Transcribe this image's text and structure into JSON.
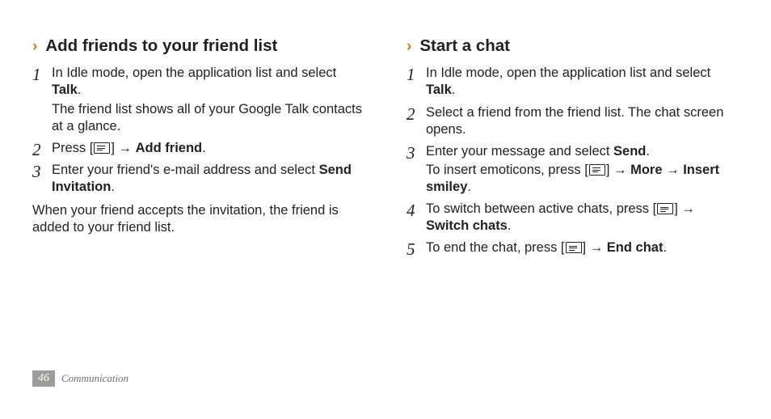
{
  "left": {
    "title": "Add friends to your friend list",
    "step1a": "In Idle mode, open the application list and select ",
    "step1a_bold": "Talk",
    "step1a_end": ".",
    "step1b": "The friend list shows all of your Google Talk contacts at a glance.",
    "step2_pre": "Press [",
    "step2_mid": "] → ",
    "step2_bold": "Add friend",
    "step2_end": ".",
    "step3_pre": "Enter your friend's e-mail address and select ",
    "step3_bold": "Send Invitation",
    "step3_end": ".",
    "closing": "When your friend accepts the invitation, the friend is added to your friend list."
  },
  "right": {
    "title": "Start a chat",
    "step1_pre": "In Idle mode, open the application list and select ",
    "step1_bold": "Talk",
    "step1_end": ".",
    "step2": "Select a friend from the friend list. The chat screen opens.",
    "step3a_pre": "Enter your message and select ",
    "step3a_bold": "Send",
    "step3a_end": ".",
    "step3b_pre": "To insert emoticons, press [",
    "step3b_mid": "] → ",
    "step3b_b1": "More",
    "step3b_arrow": " → ",
    "step3b_b2": "Insert smiley",
    "step3b_end": ".",
    "step4_pre": "To switch between active chats, press [",
    "step4_mid": "] → ",
    "step4_bold": "Switch chats",
    "step4_end": ".",
    "step5_pre": "To end the chat, press [",
    "step5_mid": "] → ",
    "step5_bold": "End chat",
    "step5_end": "."
  },
  "nums": {
    "n1": "1",
    "n2": "2",
    "n3": "3",
    "n4": "4",
    "n5": "5"
  },
  "footer": {
    "page": "46",
    "section": "Communication"
  }
}
